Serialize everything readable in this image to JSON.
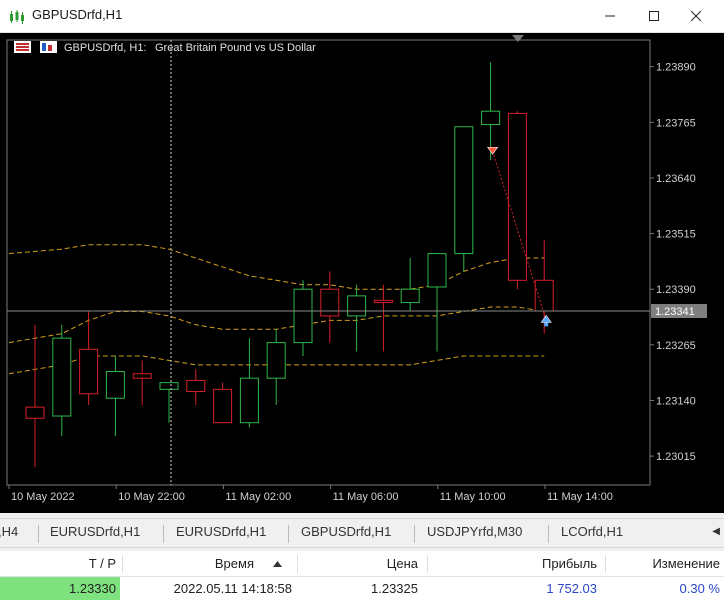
{
  "window": {
    "title": "GBPUSDrfd,H1"
  },
  "chart": {
    "symbol_label": "GBPUSDrfd, H1:",
    "description": "Great Britain Pound vs US Dollar",
    "current_price": "1.23341",
    "price_labels": [
      "1.23890",
      "1.23765",
      "1.23640",
      "1.23515",
      "1.23390",
      "1.23265",
      "1.23140",
      "1.23015"
    ],
    "time_labels": [
      "10 May 2022",
      "10 May 22:00",
      "11 May 02:00",
      "11 May 06:00",
      "11 May 10:00",
      "11 May 14:00"
    ],
    "colors": {
      "background": "#000000",
      "bull_candle": "#2fb84a",
      "bear_candle": "#d6202a",
      "envelope": "#d4a017",
      "grid": "#3a3a3a",
      "axis_text": "#d0d0d0"
    }
  },
  "chart_data": {
    "type": "candlestick",
    "symbol": "GBPUSDrfd",
    "timeframe": "H1",
    "ylim": [
      1.2295,
      1.2395
    ],
    "candles": [
      {
        "o": 1.23125,
        "h": 1.2331,
        "l": 1.2299,
        "c": 1.231
      },
      {
        "o": 1.23105,
        "h": 1.2331,
        "l": 1.2306,
        "c": 1.2328
      },
      {
        "o": 1.23255,
        "h": 1.2334,
        "l": 1.2313,
        "c": 1.23155
      },
      {
        "o": 1.23145,
        "h": 1.2324,
        "l": 1.2306,
        "c": 1.23205
      },
      {
        "o": 1.232,
        "h": 1.2323,
        "l": 1.2313,
        "c": 1.2319
      },
      {
        "o": 1.23165,
        "h": 1.2318,
        "l": 1.2309,
        "c": 1.2318
      },
      {
        "o": 1.23185,
        "h": 1.2321,
        "l": 1.2313,
        "c": 1.2316
      },
      {
        "o": 1.23165,
        "h": 1.2318,
        "l": 1.2309,
        "c": 1.2309
      },
      {
        "o": 1.2309,
        "h": 1.2328,
        "l": 1.2308,
        "c": 1.2319
      },
      {
        "o": 1.2319,
        "h": 1.233,
        "l": 1.2313,
        "c": 1.2327
      },
      {
        "o": 1.2327,
        "h": 1.2341,
        "l": 1.2324,
        "c": 1.2339
      },
      {
        "o": 1.2339,
        "h": 1.2343,
        "l": 1.2327,
        "c": 1.2333
      },
      {
        "o": 1.2333,
        "h": 1.234,
        "l": 1.2325,
        "c": 1.23375
      },
      {
        "o": 1.23365,
        "h": 1.234,
        "l": 1.2325,
        "c": 1.2336
      },
      {
        "o": 1.2336,
        "h": 1.2346,
        "l": 1.2334,
        "c": 1.2339
      },
      {
        "o": 1.23395,
        "h": 1.2347,
        "l": 1.2325,
        "c": 1.2347
      },
      {
        "o": 1.2347,
        "h": 1.2375,
        "l": 1.2343,
        "c": 1.23755
      },
      {
        "o": 1.2376,
        "h": 1.239,
        "l": 1.2368,
        "c": 1.2379
      },
      {
        "o": 1.23785,
        "h": 1.2379,
        "l": 1.2339,
        "c": 1.2341
      },
      {
        "o": 1.2341,
        "h": 1.235,
        "l": 1.2329,
        "c": 1.23341
      }
    ],
    "envelope_upper": [
      1.2347,
      1.2348,
      1.2349,
      1.2349,
      1.2349,
      1.2348,
      1.2346,
      1.2344,
      1.2342,
      1.2341,
      1.234,
      1.234,
      1.2339,
      1.2339,
      1.2339,
      1.234,
      1.2343,
      1.2345,
      1.2346,
      1.2346
    ],
    "envelope_middle": [
      1.2327,
      1.2329,
      1.2332,
      1.2334,
      1.2334,
      1.2333,
      1.2331,
      1.233,
      1.233,
      1.233,
      1.2331,
      1.2332,
      1.2332,
      1.2333,
      1.2333,
      1.2333,
      1.2334,
      1.2335,
      1.2335,
      1.2334
    ],
    "envelope_lower": [
      1.232,
      1.2322,
      1.2324,
      1.2324,
      1.2324,
      1.2323,
      1.2322,
      1.2322,
      1.2322,
      1.2322,
      1.2322,
      1.2322,
      1.2322,
      1.2322,
      1.2322,
      1.2323,
      1.2324,
      1.2324,
      1.2324,
      1.2324
    ],
    "crosshair_candle_index": 5,
    "trade_arrows": [
      {
        "candle_index": 17,
        "direction": "sell",
        "price": 1.237
      },
      {
        "candle_index": 19,
        "direction": "buy",
        "price": 1.2332
      }
    ]
  },
  "tabs": [
    {
      "label": ",H4"
    },
    {
      "label": "EURUSDrfd,H1"
    },
    {
      "label": "EURUSDrfd,H1"
    },
    {
      "label": "GBPUSDrfd,H1"
    },
    {
      "label": "USDJPYrfd,M30"
    },
    {
      "label": "LCOrfd,H1"
    }
  ],
  "table": {
    "headers": [
      "T / P",
      "Время",
      "Цена",
      "Прибыль",
      "Изменение"
    ],
    "row": {
      "tp": "1.23330",
      "time": "2022.05.11 14:18:58",
      "price": "1.23325",
      "profit": "1 752.03",
      "change": "0.30 %"
    },
    "colors": {
      "tp_bg": "#7ee27e",
      "profit_text": "#2a46c8"
    }
  }
}
